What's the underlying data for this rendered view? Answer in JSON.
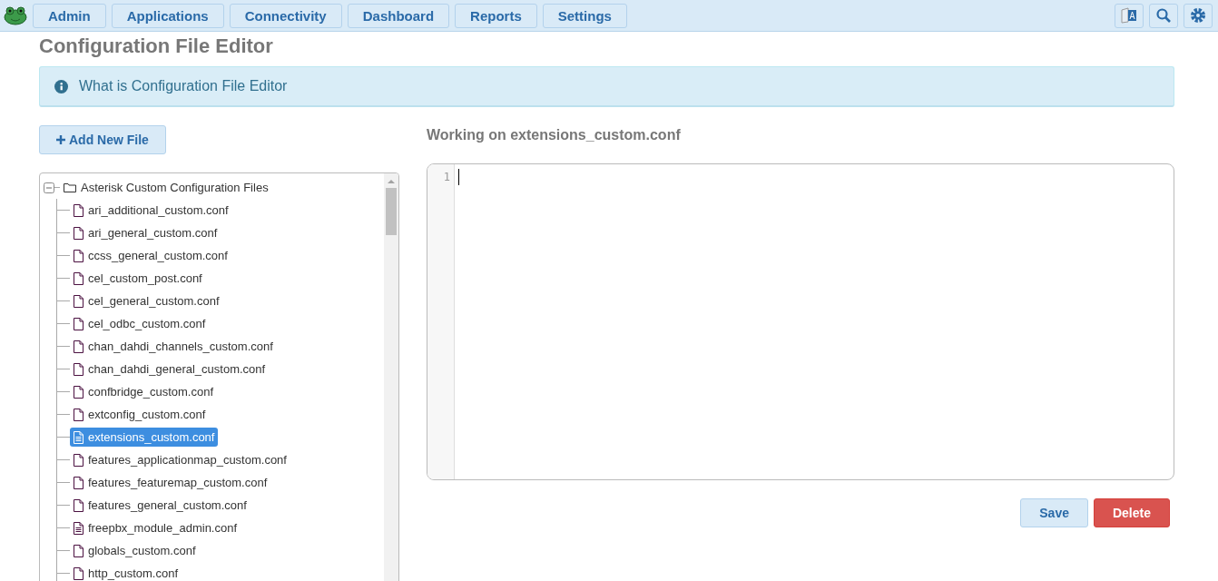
{
  "nav": {
    "items": [
      {
        "label": "Admin"
      },
      {
        "label": "Applications"
      },
      {
        "label": "Connectivity"
      },
      {
        "label": "Dashboard"
      },
      {
        "label": "Reports"
      },
      {
        "label": "Settings"
      }
    ]
  },
  "page": {
    "title": "Configuration File Editor",
    "info": "What is Configuration File Editor"
  },
  "add_button": "Add New File",
  "tree": {
    "root": {
      "label": "Asterisk Custom Configuration Files",
      "expanded": true,
      "children": [
        {
          "label": "ari_additional_custom.conf",
          "kind": "blank",
          "selected": false
        },
        {
          "label": "ari_general_custom.conf",
          "kind": "blank",
          "selected": false
        },
        {
          "label": "ccss_general_custom.conf",
          "kind": "blank",
          "selected": false
        },
        {
          "label": "cel_custom_post.conf",
          "kind": "blank",
          "selected": false
        },
        {
          "label": "cel_general_custom.conf",
          "kind": "blank",
          "selected": false
        },
        {
          "label": "cel_odbc_custom.conf",
          "kind": "blank",
          "selected": false
        },
        {
          "label": "chan_dahdi_channels_custom.conf",
          "kind": "blank",
          "selected": false
        },
        {
          "label": "chan_dahdi_general_custom.conf",
          "kind": "blank",
          "selected": false
        },
        {
          "label": "confbridge_custom.conf",
          "kind": "blank",
          "selected": false
        },
        {
          "label": "extconfig_custom.conf",
          "kind": "blank",
          "selected": false
        },
        {
          "label": "extensions_custom.conf",
          "kind": "text",
          "selected": true
        },
        {
          "label": "features_applicationmap_custom.conf",
          "kind": "blank",
          "selected": false
        },
        {
          "label": "features_featuremap_custom.conf",
          "kind": "blank",
          "selected": false
        },
        {
          "label": "features_general_custom.conf",
          "kind": "blank",
          "selected": false
        },
        {
          "label": "freepbx_module_admin.conf",
          "kind": "text",
          "selected": false
        },
        {
          "label": "globals_custom.conf",
          "kind": "blank",
          "selected": false
        },
        {
          "label": "http_custom.conf",
          "kind": "blank",
          "selected": false
        }
      ]
    }
  },
  "editor": {
    "heading": "Working on extensions_custom.conf",
    "line_numbers": [
      "1"
    ]
  },
  "actions": [
    {
      "label": "Save",
      "kind": "primary"
    },
    {
      "label": "Delete",
      "kind": "danger"
    }
  ]
}
